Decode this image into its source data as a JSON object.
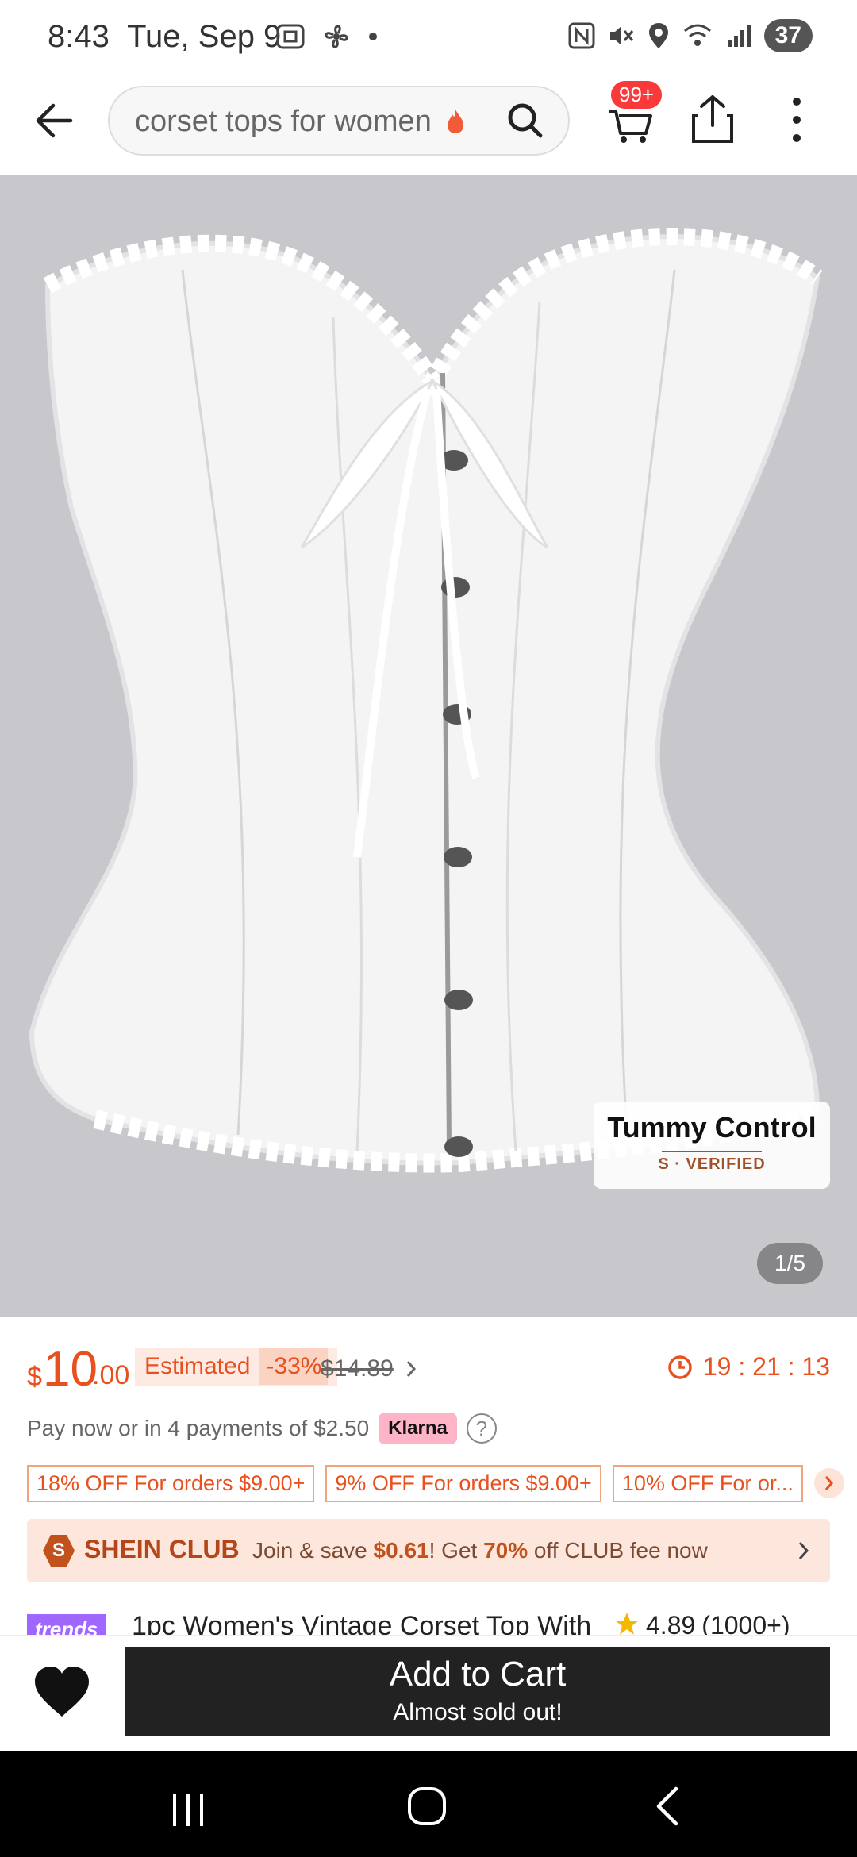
{
  "status_bar": {
    "time": "8:43",
    "date": "Tue, Sep 9",
    "battery": "37"
  },
  "top_bar": {
    "search_query": "corset tops for women",
    "cart_badge": "99+"
  },
  "product_image": {
    "badge_title": "Tummy Control",
    "badge_sub": "S · VERIFIED",
    "counter": "1/5"
  },
  "price": {
    "currency": "$",
    "integer": "10",
    "decimal": ".00",
    "estimated_label": "Estimated",
    "discount": "-33%",
    "original": "$14.89",
    "timer": "19 : 21 : 13"
  },
  "payment": {
    "text": "Pay now or in 4 payments of $2.50",
    "provider": "Klarna"
  },
  "coupons": [
    "18% OFF For orders $9.00+",
    "9% OFF For orders $9.00+",
    "10% OFF For or..."
  ],
  "club": {
    "name": "SHEIN CLUB",
    "desc_prefix": "Join & save ",
    "save_amount": "$0.61",
    "desc_mid": "! Get ",
    "off_pct": "70%",
    "desc_suffix": " off CLUB fee now"
  },
  "product": {
    "trends_label": "trends",
    "title": "1pc Women's Vintage Corset Top With",
    "rating": "4.89",
    "review_count": "(1000+)"
  },
  "action_bar": {
    "add_to_cart": "Add to Cart",
    "stock_note": "Almost sold out!"
  },
  "colors": {
    "accent": "#e8501e",
    "cta_bg": "#222222",
    "cart_badge": "#fa3a3a"
  }
}
